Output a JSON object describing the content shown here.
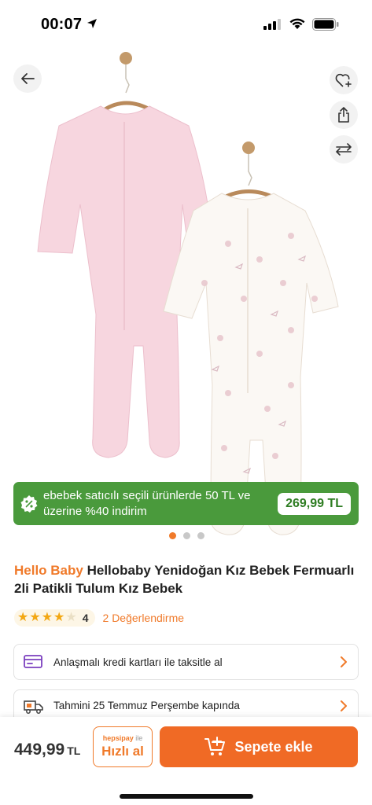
{
  "status_bar": {
    "time": "00:07"
  },
  "product": {
    "brand": "Hello Baby",
    "title": "Hellobaby Yenidoğan Kız Bebek Fermuarlı 2li Patikli Tulum Kız Bebek",
    "image_count": 3,
    "active_image_index": 0
  },
  "promo": {
    "text": "ebebek satıcılı seçili ürünlerde 50 TL ve üzerine %40 indirim",
    "price": "269,99 TL"
  },
  "rating": {
    "stars": 4,
    "max_stars": 5,
    "count": "4",
    "reviews_label": "2 Değerlendirme"
  },
  "info_rows": [
    {
      "icon": "credit-card-icon",
      "label": "Anlaşmalı kredi kartları ile taksitle al"
    },
    {
      "icon": "delivery-truck-icon",
      "label": "Tahmini 25 Temmuz Perşembe kapında"
    }
  ],
  "bottom_bar": {
    "price": "449,99",
    "currency": "TL",
    "hizli_provider": "hepsipay",
    "hizli_suffix": "ile",
    "hizli_label": "Hızlı al",
    "cart_label": "Sepete ekle"
  },
  "colors": {
    "accent": "#f07a2a",
    "promo_green": "#4a9a3c",
    "cart_orange": "#f06a25",
    "star": "#f3a712"
  }
}
